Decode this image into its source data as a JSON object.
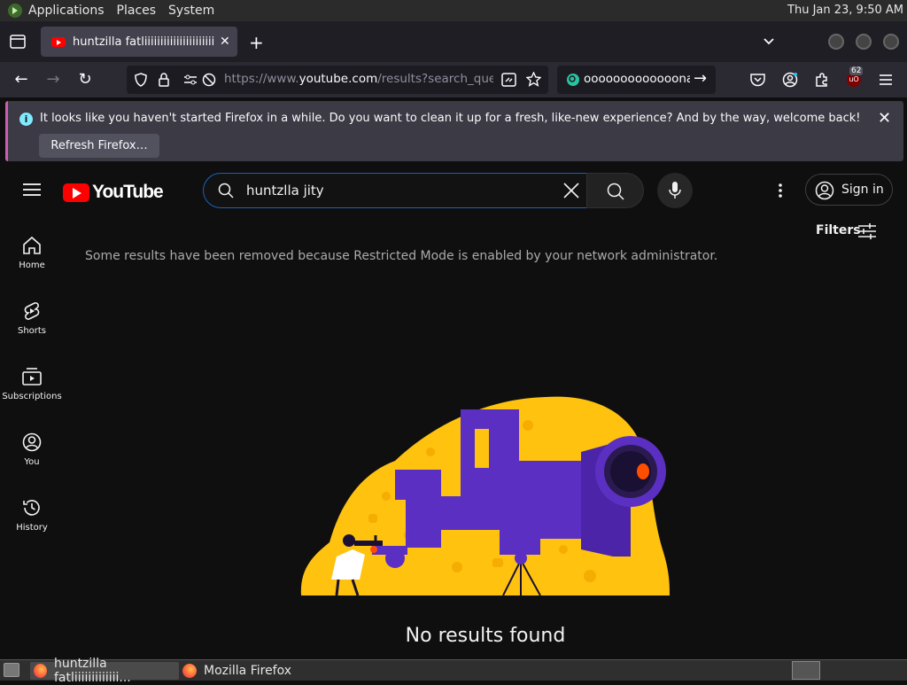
{
  "panel": {
    "menus": [
      "Applications",
      "Places",
      "System"
    ],
    "clock": "Thu Jan 23,  9:50 AM"
  },
  "browser": {
    "tab_title": "huntzilla fatliiiiiiiiiiiiiiiiiiiiiii",
    "url_prefix": "https://www.",
    "url_domain": "youtube.com",
    "url_rest": "/results?search_query",
    "search_text": "ooooooooooooonan",
    "badge_count": "62"
  },
  "notification": {
    "message": "It looks like you haven't started Firefox in a while. Do you want to clean it up for a fresh, like-new experience? And by the way, welcome back!",
    "button_label": "Refresh Firefox…"
  },
  "youtube": {
    "logo_text": "YouTube",
    "search_query": "huntzlla jity",
    "sign_in": "Sign in",
    "filters": "Filters",
    "restricted_notice": "Some results have been removed because Restricted Mode is enabled by your network administrator.",
    "no_results": "No results found",
    "sidebar": [
      {
        "label": "Home"
      },
      {
        "label": "Shorts"
      },
      {
        "label": "Subscriptions"
      },
      {
        "label": "You"
      },
      {
        "label": "History"
      }
    ]
  },
  "taskbar": {
    "items": [
      "huntzilla fatliiiiiiiiiiiii...",
      "Mozilla Firefox"
    ]
  },
  "colors": {
    "yt_red": "#ff0000",
    "illustration_yellow": "#ffc20e",
    "illustration_purple": "#5a2fc2",
    "search_focus": "#1c62b9"
  }
}
